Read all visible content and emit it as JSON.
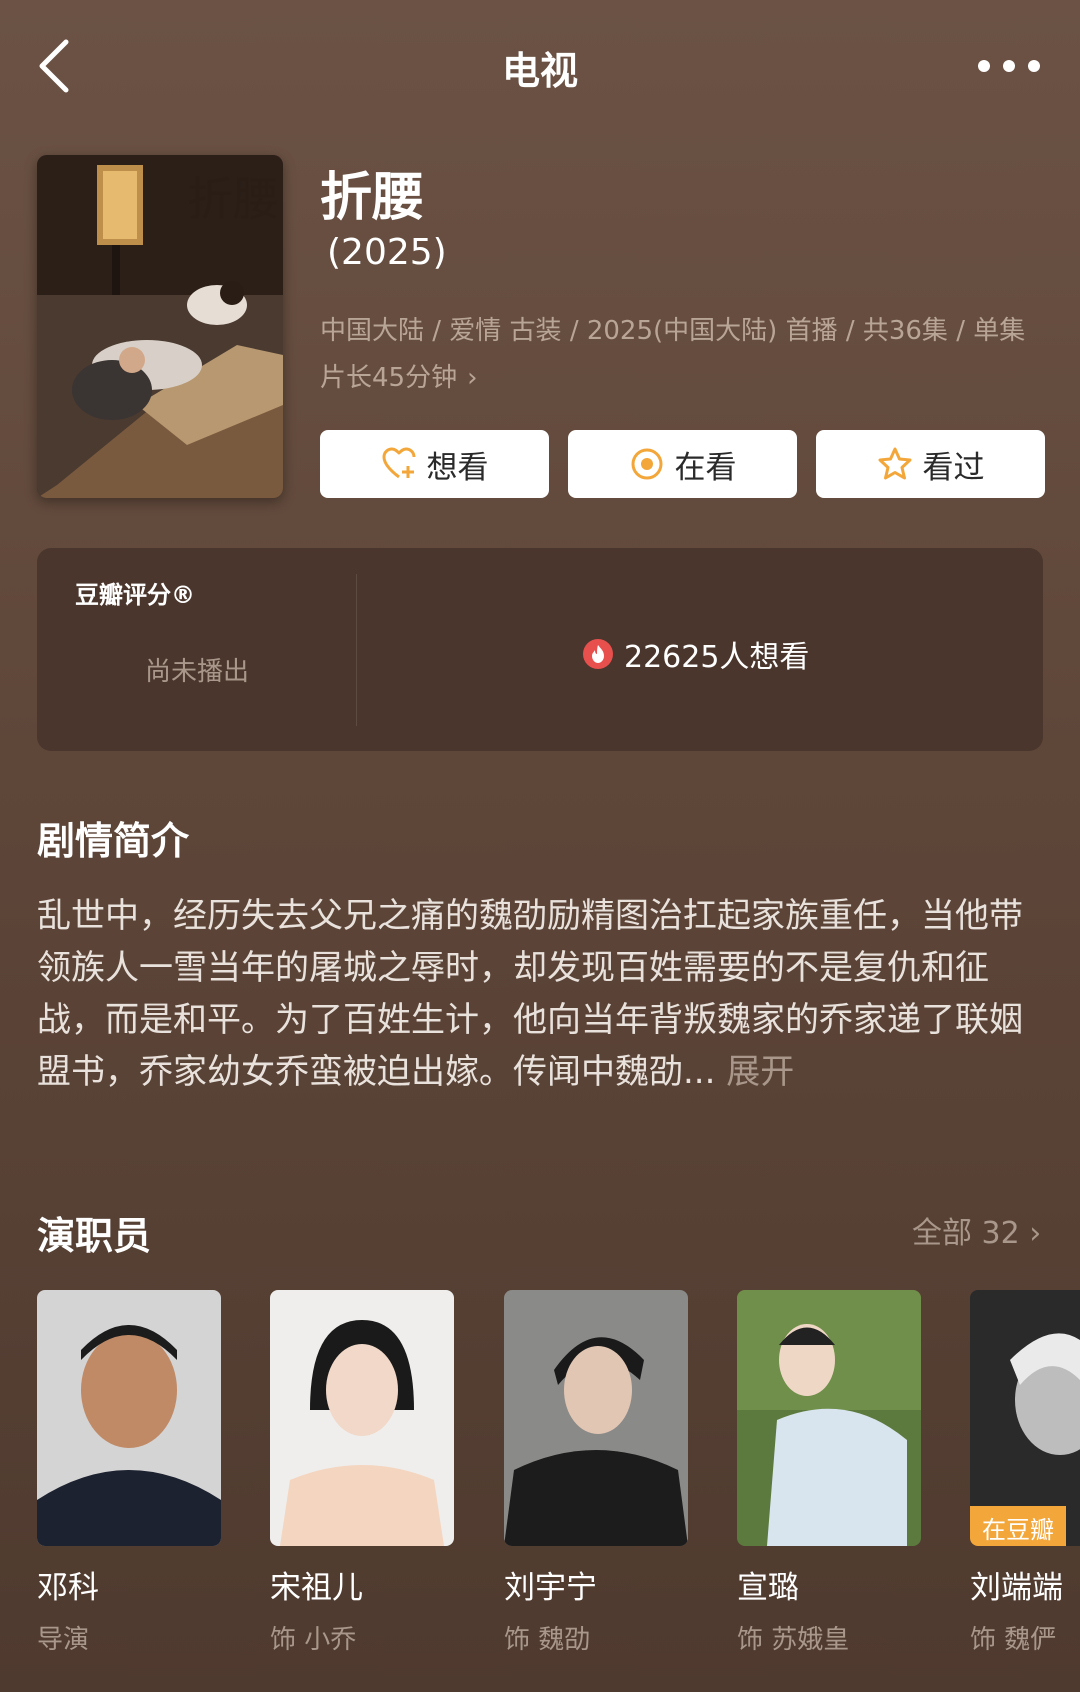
{
  "header": {
    "title": "电视"
  },
  "movie": {
    "title": "折腰",
    "year": "(2025)",
    "meta": "中国大陆 / 爱情 古装 / 2025(中国大陆) 首播 / 共36集 / 单集片长45分钟",
    "poster_title": "折腰"
  },
  "actions": {
    "want": "想看",
    "watching": "在看",
    "watched": "看过"
  },
  "rating": {
    "label": "豆瓣评分®",
    "status": "尚未播出",
    "wish": "22625人想看"
  },
  "synopsis": {
    "heading": "剧情简介",
    "text": "乱世中，经历失去父兄之痛的魏劭励精图治扛起家族重任，当他带领族人一雪当年的屠城之辱时，却发现百姓需要的不是复仇和征战，而是和平。为了百姓生计，他向当年背叛魏家的乔家递了联姻盟书，乔家幼女乔蛮被迫出嫁。传闻中魏劭...",
    "expand": "展开"
  },
  "cast": {
    "heading": "演职员",
    "all": "全部 32",
    "members": [
      {
        "name": "邓科",
        "role": "导演"
      },
      {
        "name": "宋祖儿",
        "role": "饰 小乔"
      },
      {
        "name": "刘宇宁",
        "role": "饰 魏劭"
      },
      {
        "name": "宣璐",
        "role": "饰 苏娥皇"
      },
      {
        "name": "刘端端",
        "role": "饰 魏俨",
        "badge": "在豆瓣"
      }
    ]
  },
  "colors": {
    "background": "#5e4639",
    "accent": "#f3a73a",
    "muted": "#a8978a",
    "card": "#4a362c"
  }
}
